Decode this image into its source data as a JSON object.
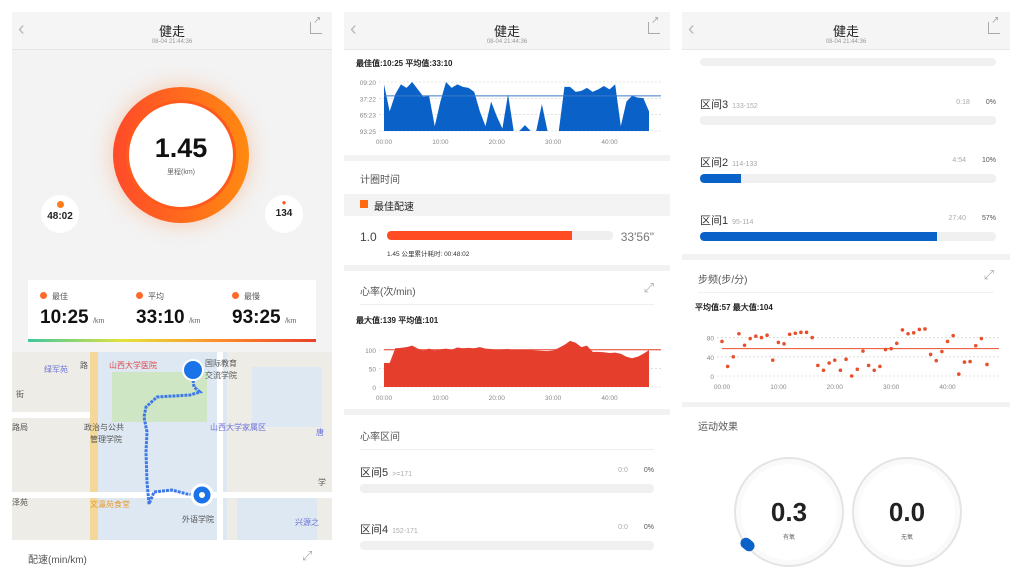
{
  "header": {
    "title": "健走",
    "datetime": "08-04 21:44:36"
  },
  "summary": {
    "distance": "1.45",
    "distance_label": "里程(km)",
    "duration": "48:02",
    "calories": "134"
  },
  "pace_stats": [
    {
      "label": "最佳",
      "value": "10:25",
      "unit": "/km"
    },
    {
      "label": "平均",
      "value": "33:10",
      "unit": "/km"
    },
    {
      "label": "最慢",
      "value": "93:25",
      "unit": "/km"
    }
  ],
  "map": {
    "labels": [
      "绿军苑",
      "路",
      "山西大学医院",
      "国际教育",
      "交流学院",
      "街",
      "路局",
      "政治与公共",
      "管理学院",
      "山西大学家属区",
      "唐",
      "学",
      "泽苑",
      "文瀛苑食堂",
      "外语学院",
      "兴源之"
    ]
  },
  "pace_section": {
    "title": "配速(min/km)",
    "stats": "最佳值:10:25 平均值:33:10"
  },
  "lap_section": {
    "title": "计圈时间",
    "legend": "最佳配速",
    "laps": [
      {
        "km": "1.0",
        "time": "33'56\"",
        "progress": 0.82,
        "note": "1.45 公里累计耗时: 00:48:02"
      }
    ]
  },
  "heart_section": {
    "title": "心率(次/min)",
    "stats": "最大值:139 平均值:101"
  },
  "zones_section": {
    "title": "心率区间",
    "zones": [
      {
        "name": "区间5",
        "range": ">=171",
        "time": "0:0",
        "pct": "0%",
        "fraction": 0
      },
      {
        "name": "区间4",
        "range": "152-171",
        "time": "0:0",
        "pct": "0%",
        "fraction": 0
      },
      {
        "name": "区间3",
        "range": "133-152",
        "time": "0:18",
        "pct": "0%",
        "fraction": 0
      },
      {
        "name": "区间2",
        "range": "114-133",
        "time": "4:54",
        "pct": "10%",
        "fraction": 0.14
      },
      {
        "name": "区间1",
        "range": "95-114",
        "time": "27:40",
        "pct": "57%",
        "fraction": 0.8
      }
    ]
  },
  "cadence_section": {
    "title": "步频(步/分)",
    "stats": "平均值:57 最大值:104"
  },
  "effect_section": {
    "title": "运动效果",
    "aerobic": "0.3",
    "aerobic_label": "有氧",
    "anaerobic": "0.0",
    "anaerobic_label": "无氧",
    "aerobic_fraction": 0.06
  },
  "colors": {
    "orange": "#ff6a2b",
    "blue": "#0a62c9",
    "red": "#e63e2d"
  },
  "chart_data": [
    {
      "type": "area",
      "title": "配速(min/km)",
      "y_unit": "min",
      "yticks": [
        "09:20",
        "37:22",
        "65:23",
        "93:25"
      ],
      "ytick_values": [
        9.33,
        37.37,
        65.38,
        93.42
      ],
      "y_inverted": true,
      "xticks": [
        "00:00",
        "10:00",
        "20:00",
        "30:00",
        "40:00"
      ],
      "average": 33.17,
      "x": [
        0,
        1,
        2,
        3,
        4,
        5,
        6,
        7,
        8,
        9,
        10,
        11,
        12,
        13,
        14,
        15,
        16,
        17,
        18,
        19,
        20,
        21,
        22,
        23,
        24,
        25,
        26,
        27,
        28,
        29,
        30,
        31,
        32,
        33,
        34,
        35,
        36,
        37,
        38,
        39,
        40,
        41,
        42,
        43,
        44,
        45,
        46,
        47
      ],
      "values": [
        13.5,
        59.8,
        30.4,
        13.5,
        19.4,
        9.3,
        21.9,
        34.6,
        32.9,
        85.0,
        43.0,
        9.3,
        19.4,
        13.5,
        17.7,
        19.4,
        26.2,
        59.8,
        85.0,
        43.0,
        68.2,
        89.2,
        30.4,
        93.4,
        93.4,
        83.3,
        93.4,
        93.4,
        47.2,
        93.4,
        93.4,
        93.4,
        17.7,
        17.7,
        26.2,
        24.5,
        19.4,
        26.2,
        21.9,
        16.1,
        21.9,
        13.5,
        85.0,
        43.0,
        32.9,
        36.2,
        37.1,
        59.8
      ]
    },
    {
      "type": "area",
      "title": "心率(次/min)",
      "yticks": [
        "0",
        "50",
        "100"
      ],
      "ytick_values": [
        0,
        50,
        100
      ],
      "ylim": [
        0,
        130
      ],
      "xticks": [
        "00:00",
        "10:00",
        "20:00",
        "30:00",
        "40:00"
      ],
      "average": 101,
      "x": [
        0,
        1,
        2,
        3,
        4,
        5,
        6,
        7,
        8,
        9,
        10,
        11,
        12,
        13,
        14,
        15,
        16,
        17,
        18,
        19,
        20,
        21,
        22,
        23,
        24,
        25,
        26,
        27,
        28,
        29,
        30,
        31,
        32,
        33,
        34,
        35,
        36,
        37,
        38,
        39,
        40,
        41,
        42,
        43,
        44,
        45,
        46,
        47
      ],
      "values": [
        65,
        65,
        105,
        106,
        108,
        112,
        104,
        99,
        104,
        99,
        102,
        104,
        101,
        107,
        105,
        106,
        105,
        108,
        104,
        103,
        101,
        102,
        103,
        100,
        101,
        102,
        101,
        99,
        98,
        97,
        99,
        106,
        114,
        125,
        120,
        108,
        112,
        95,
        95,
        94,
        92,
        93,
        90,
        82,
        78,
        82,
        90,
        100
      ]
    },
    {
      "type": "scatter",
      "title": "步频(步/分)",
      "yticks": [
        "0",
        "40",
        "80"
      ],
      "ytick_values": [
        0,
        40,
        80
      ],
      "ylim": [
        0,
        100
      ],
      "xticks": [
        "00:00",
        "10:00",
        "20:00",
        "30:00",
        "40:00"
      ],
      "average": 57,
      "x": [
        0,
        1,
        2,
        3,
        4,
        5,
        6,
        7,
        8,
        9,
        10,
        11,
        12,
        13,
        14,
        15,
        16,
        17,
        18,
        19,
        20,
        21,
        22,
        23,
        24,
        25,
        26,
        27,
        28,
        29,
        30,
        31,
        32,
        33,
        34,
        35,
        36,
        37,
        38,
        39,
        40,
        41,
        42,
        43,
        44,
        45,
        46,
        47
      ],
      "values": [
        72,
        20,
        40,
        88,
        64,
        78,
        83,
        80,
        85,
        33,
        70,
        67,
        87,
        89,
        91,
        91,
        80,
        22,
        12,
        27,
        33,
        12,
        35,
        0,
        14,
        52,
        22,
        12,
        20,
        55,
        57,
        68,
        96,
        88,
        90,
        97,
        98,
        45,
        32,
        51,
        72,
        84,
        4,
        29,
        30,
        63,
        78,
        24
      ]
    }
  ]
}
